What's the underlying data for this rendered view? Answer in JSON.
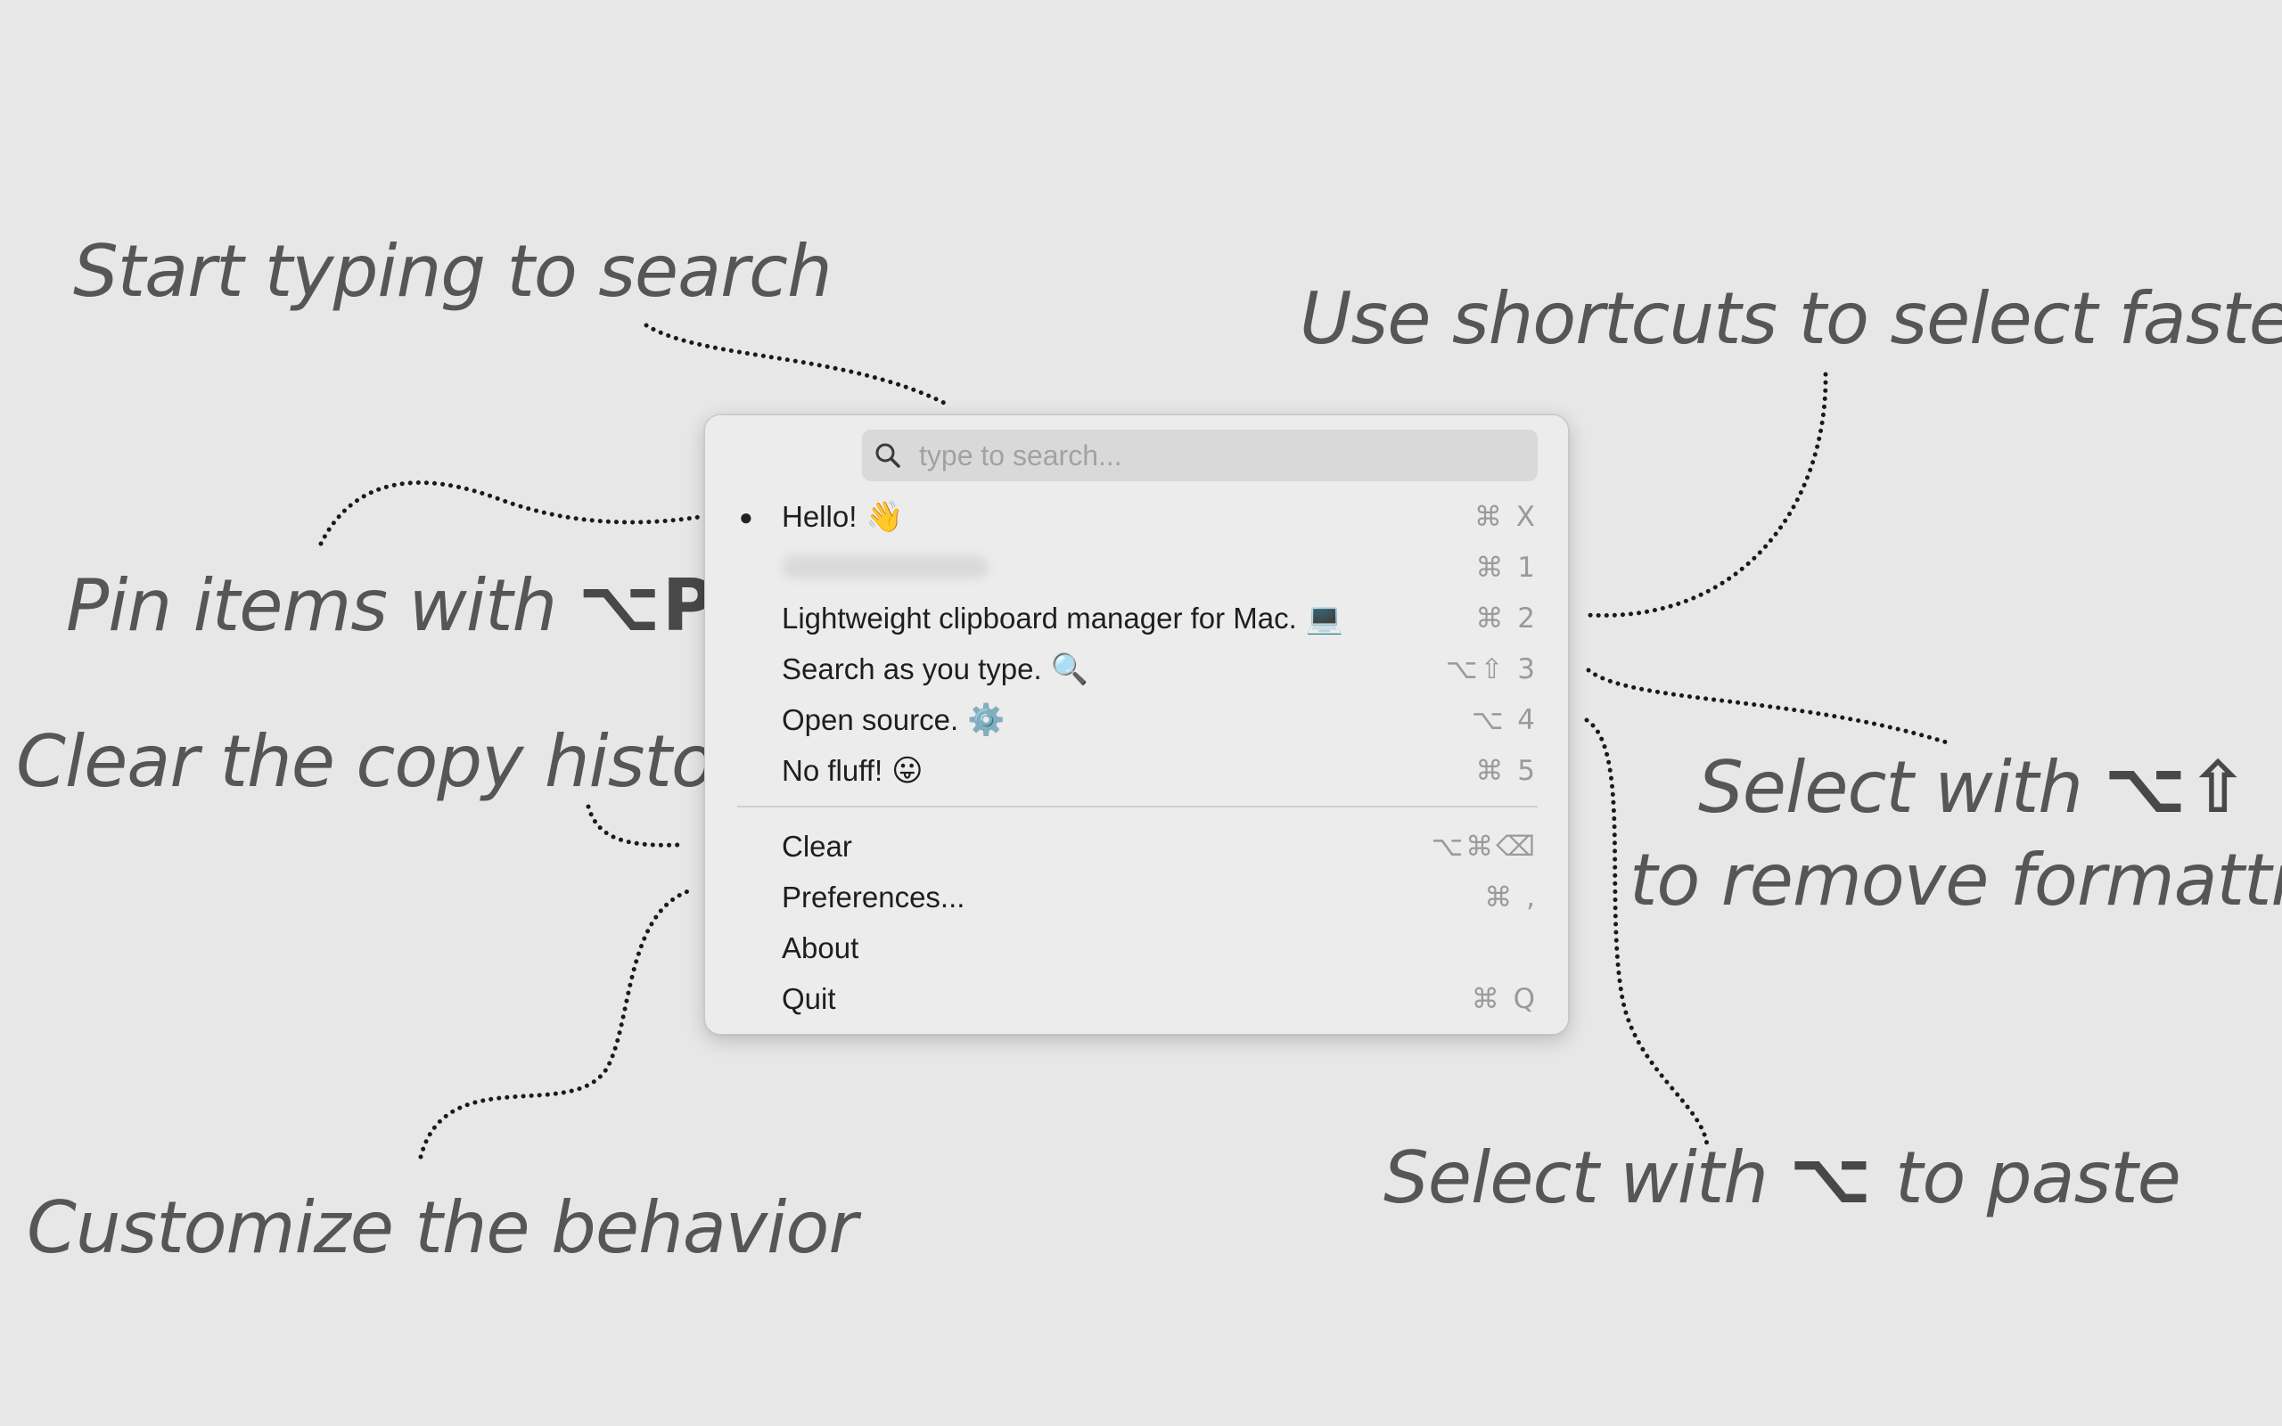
{
  "annotations": {
    "search_hint": "Start typing to search",
    "shortcuts_hint": "Use shortcuts to select faster",
    "pin_hint_text": "Pin items with",
    "pin_hint_keys": "⌥P",
    "clear_hint": "Clear the copy history",
    "remove_format_line1_text": "Select with",
    "remove_format_line1_keys": "⌥⇧",
    "remove_format_line2": "to remove formatting",
    "paste_hint_text": "Select with",
    "paste_hint_keys": "⌥",
    "paste_hint_suffix": "to paste",
    "customize_hint": "Customize the behavior"
  },
  "search": {
    "placeholder": "type to search...",
    "value": "",
    "icon": "magnifier-icon"
  },
  "history": [
    {
      "label": "Hello!",
      "emoji": "👋",
      "shortcut": "⌘ X",
      "pinned": true
    },
    {
      "label": "",
      "emoji": "",
      "shortcut": "⌘ 1",
      "blurred": true
    },
    {
      "label": "Lightweight clipboard manager for Mac.",
      "emoji": "💻",
      "shortcut": "⌘ 2"
    },
    {
      "label": "Search as you type.",
      "emoji": "🔍",
      "shortcut": "⌥⇧ 3"
    },
    {
      "label": "Open source.",
      "emoji": "⚙️",
      "shortcut": "⌥ 4"
    },
    {
      "label": "No fluff!",
      "emoji": "😛",
      "shortcut": "⌘ 5"
    }
  ],
  "actions": [
    {
      "label": "Clear",
      "shortcut": "⌥⌘⌫"
    },
    {
      "label": "Preferences...",
      "shortcut": "⌘ ,"
    },
    {
      "label": "About",
      "shortcut": ""
    },
    {
      "label": "Quit",
      "shortcut": "⌘ Q"
    }
  ],
  "colors": {
    "background": "#e7e7e7",
    "menu_background": "#ececec",
    "search_field": "#d9d9d9",
    "annotation_text": "#565656",
    "shortcut_text": "#9a9a9a"
  }
}
